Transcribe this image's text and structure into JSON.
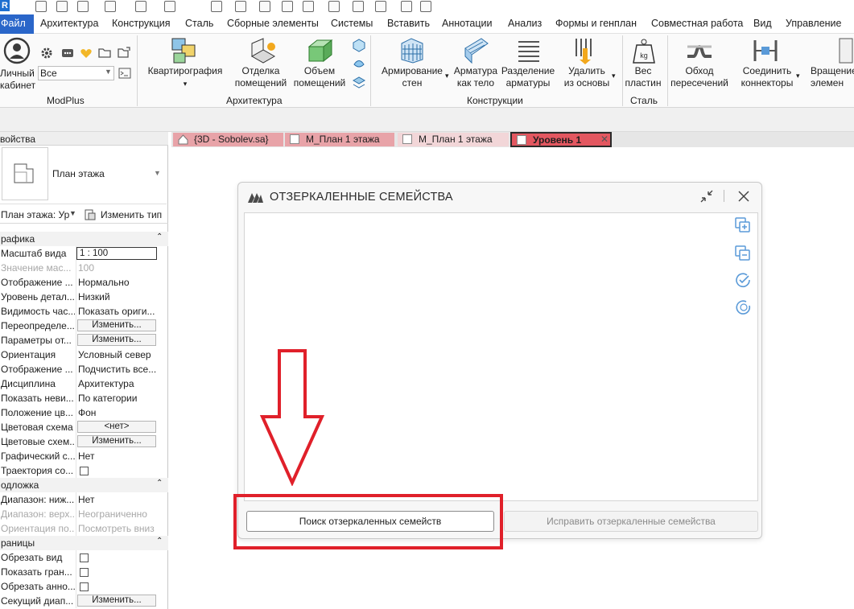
{
  "quick_access": {
    "logo": "R"
  },
  "menu": {
    "file": "Файл",
    "items": [
      "Архитектура",
      "Конструкция",
      "Сталь",
      "Сборные элементы",
      "Системы",
      "Вставить",
      "Аннотации",
      "Анализ",
      "Формы и генплан",
      "Совместная работа",
      "Вид",
      "Управление"
    ]
  },
  "ribbon": {
    "modplus": {
      "cabinet_label": "Личный\nкабинет",
      "combo_value": "Все",
      "panel_title": "ModPlus"
    },
    "architecture": {
      "items": [
        {
          "label": "Квартирография",
          "dropdown": "▾"
        },
        {
          "label": "Отделка\nпомещений"
        },
        {
          "label": "Объем\nпомещений"
        }
      ],
      "panel_title": "Архитектура"
    },
    "constructions": {
      "items": [
        {
          "label": "Армирование\nстен"
        },
        {
          "label": "Арматура\nкак тело"
        },
        {
          "label": "Разделение\nарматуры"
        },
        {
          "label": "Удалить\nиз основы"
        }
      ],
      "panel_title": "Конструкции"
    },
    "steel": {
      "items": [
        {
          "label": "Вес\nпластин"
        }
      ],
      "panel_title": "Сталь"
    },
    "systems": {
      "items": [
        {
          "label": "Обход\nпересечений"
        },
        {
          "label": "Соединить\nконнекторы"
        },
        {
          "label": "Вращение\nэлемен"
        }
      ]
    }
  },
  "properties": {
    "title": "войства",
    "type_name": "План этажа",
    "type_filter": "План этажа: Ур",
    "edit_type": "Изменить тип",
    "categories": [
      {
        "label": "рафика",
        "rows": [
          {
            "k": "Масштаб вида",
            "v": "1 : 100",
            "kind": "input"
          },
          {
            "k": "Значение мас...",
            "v": "100",
            "kind": "dim"
          },
          {
            "k": "Отображение ...",
            "v": "Нормально"
          },
          {
            "k": "Уровень детал...",
            "v": "Низкий"
          },
          {
            "k": "Видимость час...",
            "v": "Показать ориги..."
          },
          {
            "k": "Переопределе...",
            "v": "Изменить...",
            "kind": "button"
          },
          {
            "k": "Параметры от...",
            "v": "Изменить...",
            "kind": "button"
          },
          {
            "k": "Ориентация",
            "v": "Условный север"
          },
          {
            "k": "Отображение ...",
            "v": "Подчистить все..."
          },
          {
            "k": "Дисциплина",
            "v": "Архитектура"
          },
          {
            "k": "Показать неви...",
            "v": "По категории"
          },
          {
            "k": "Положение цв...",
            "v": "Фон"
          },
          {
            "k": "Цветовая схема",
            "v": "<нет>",
            "kind": "button"
          },
          {
            "k": "Цветовые схем...",
            "v": "Изменить...",
            "kind": "button"
          },
          {
            "k": "Графический с...",
            "v": "Нет"
          },
          {
            "k": "Траектория со...",
            "v": "",
            "kind": "check"
          }
        ]
      },
      {
        "label": "одложка",
        "rows": [
          {
            "k": "Диапазон: ниж...",
            "v": "Нет"
          },
          {
            "k": "Диапазон: верх...",
            "v": "Неограниченно",
            "kind": "dim"
          },
          {
            "k": "Ориентация по...",
            "v": "Посмотреть вниз",
            "kind": "dim"
          }
        ]
      },
      {
        "label": "раницы",
        "rows": [
          {
            "k": "Обрезать вид",
            "v": "",
            "kind": "check"
          },
          {
            "k": "Показать гран...",
            "v": "",
            "kind": "check"
          },
          {
            "k": "Обрезать анно...",
            "v": "",
            "kind": "check"
          },
          {
            "k": "Секущий диап...",
            "v": "Изменить...",
            "kind": "button"
          }
        ]
      }
    ]
  },
  "tabs": [
    {
      "label": "{3D - Sobolev.sa}",
      "bg": "#e8a3a8"
    },
    {
      "label": "М_План 1 этажа",
      "bg": "#e8a3a8"
    },
    {
      "label": "М_План 1 этажа",
      "bg": "#f2d6d8"
    },
    {
      "label": "Уровень 1",
      "bg": "#e35760",
      "active": true
    }
  ],
  "dialog": {
    "title": "ОТЗЕРКАЛЕННЫЕ СЕМЕЙСТВА",
    "find_button": "Поиск отзеркаленных семейств",
    "fix_button": "Исправить отзеркаленные семейства"
  },
  "colors": {
    "accent": "#2a66c9",
    "annotation_red": "#e0202a",
    "icon_blue": "#5a9ad8"
  }
}
